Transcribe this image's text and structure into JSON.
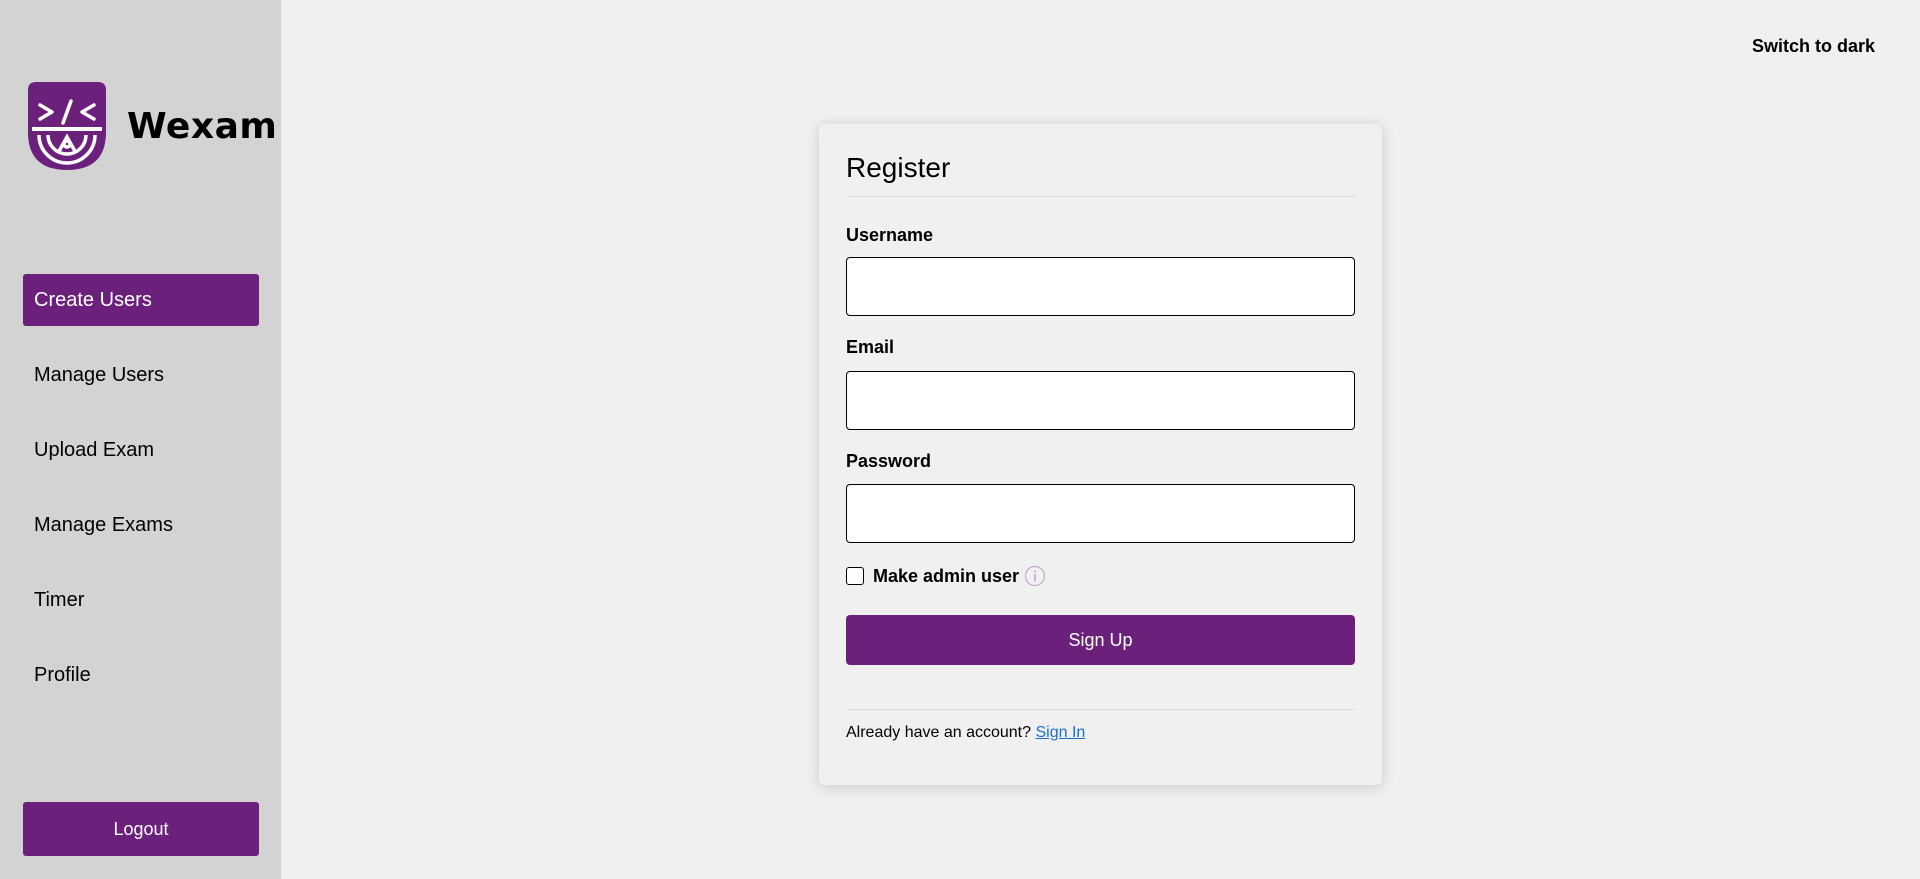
{
  "app": {
    "name": "Wexam",
    "logo_icon": "shield-code-logo",
    "accent_color": "#6b217c"
  },
  "sidebar": {
    "items": [
      {
        "label": "Create Users",
        "active": true
      },
      {
        "label": "Manage Users",
        "active": false
      },
      {
        "label": "Upload Exam",
        "active": false
      },
      {
        "label": "Manage Exams",
        "active": false
      },
      {
        "label": "Timer",
        "active": false
      },
      {
        "label": "Profile",
        "active": false
      }
    ],
    "logout_label": "Logout"
  },
  "header": {
    "theme_toggle_label": "Switch to dark"
  },
  "form": {
    "title": "Register",
    "username_label": "Username",
    "username_value": "",
    "email_label": "Email",
    "email_value": "",
    "password_label": "Password",
    "password_value": "",
    "admin_checkbox_label": "Make admin user",
    "admin_checked": false,
    "info_icon": "info-icon",
    "submit_label": "Sign Up",
    "footer_text": "Already have an account?",
    "signin_link": "Sign In"
  }
}
